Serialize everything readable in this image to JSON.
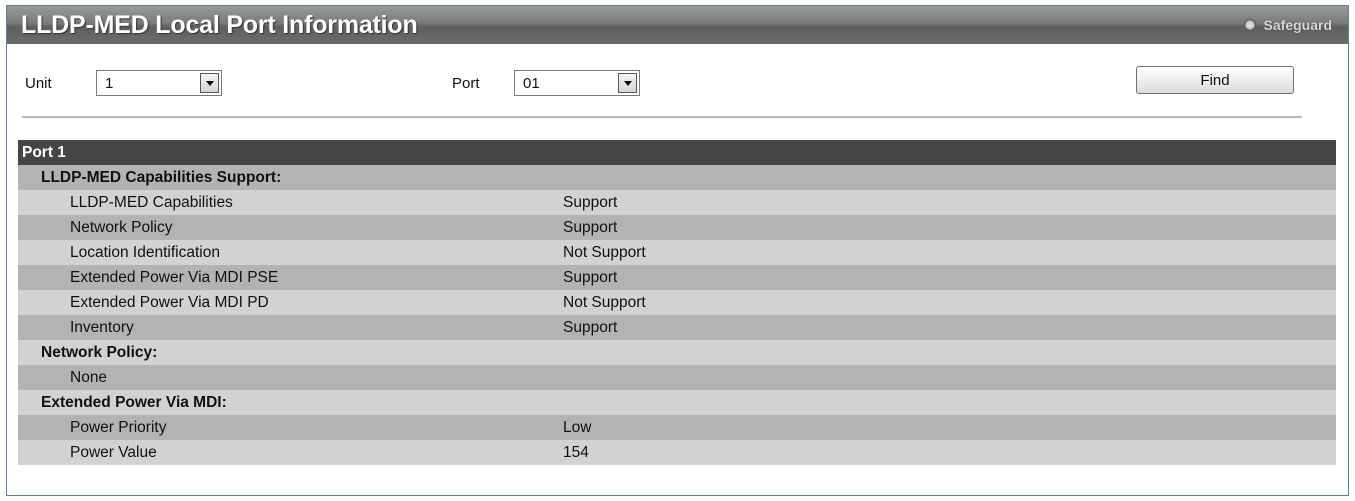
{
  "header": {
    "title": "LLDP-MED Local Port Information",
    "safeguard_label": "Safeguard"
  },
  "controls": {
    "unit_label": "Unit",
    "unit_value": "1",
    "port_label": "Port",
    "port_value": "01",
    "find_label": "Find"
  },
  "table": {
    "port_heading": "Port 1",
    "capabilities": {
      "heading": "LLDP-MED Capabilities Support:",
      "rows": [
        {
          "name": "LLDP-MED Capabilities",
          "value": "Support"
        },
        {
          "name": "Network Policy",
          "value": "Support"
        },
        {
          "name": "Location Identification",
          "value": "Not Support"
        },
        {
          "name": "Extended Power Via MDI PSE",
          "value": "Support"
        },
        {
          "name": "Extended Power Via MDI PD",
          "value": "Not Support"
        },
        {
          "name": "Inventory",
          "value": "Support"
        }
      ]
    },
    "network_policy": {
      "heading": "Network Policy:",
      "value": "None"
    },
    "power": {
      "heading": "Extended Power Via MDI:",
      "rows": [
        {
          "name": "Power Priority",
          "value": "Low"
        },
        {
          "name": "Power Value",
          "value": "154"
        }
      ]
    }
  },
  "colors": {
    "title_bar": "#6c6c6c",
    "port_header": "#454545",
    "row_dark": "#b3b3b3",
    "row_light": "#d2d2d2"
  }
}
